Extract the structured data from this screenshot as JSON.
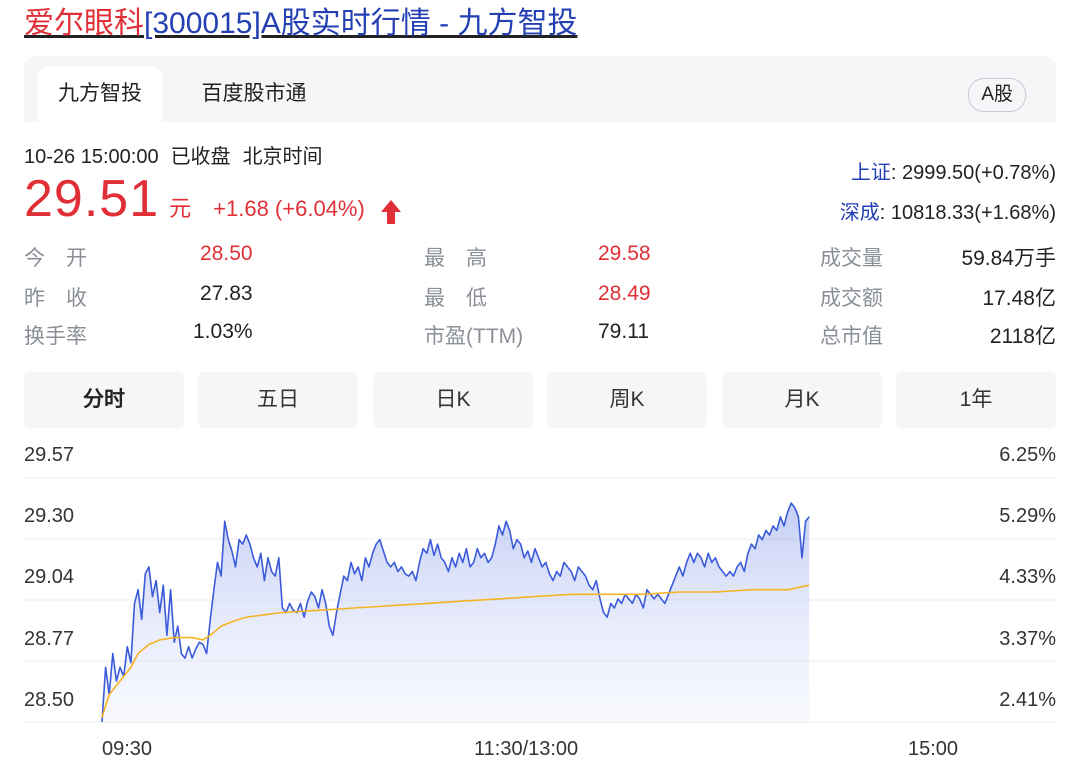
{
  "header": {
    "title_stock": "爱尔眼科",
    "title_rest": "[300015]A股实时行情 - 九方智投"
  },
  "tabs": [
    {
      "label": "九方智投",
      "active": true
    },
    {
      "label": "百度股市通",
      "active": false
    }
  ],
  "market_badge": "A股",
  "quote": {
    "datetime": "10-26 15:00:00",
    "status": "已收盘",
    "timezone": "北京时间",
    "price": "29.51",
    "unit": "元",
    "change": "+1.68 (+6.04%)"
  },
  "indices": [
    {
      "name": "上证",
      "value": ": 2999.50(+0.78%)"
    },
    {
      "name": "深成",
      "value": ": 10818.33(+1.68%)"
    }
  ],
  "stats": {
    "open_label": "今　开",
    "open": "28.50",
    "prev_close_label": "昨　收",
    "prev_close": "27.83",
    "turnover_label": "换手率",
    "turnover": "1.03%",
    "high_label": "最　高",
    "high": "29.58",
    "low_label": "最　低",
    "low": "28.49",
    "pe_label": "市盈(TTM)",
    "pe": "79.11",
    "volume_label": "成交量",
    "volume": "59.84万手",
    "amount_label": "成交额",
    "amount": "17.48亿",
    "mktcap_label": "总市值",
    "mktcap": "2118亿"
  },
  "periods": [
    {
      "label": "分时",
      "active": true
    },
    {
      "label": "五日",
      "active": false
    },
    {
      "label": "日K",
      "active": false
    },
    {
      "label": "周K",
      "active": false
    },
    {
      "label": "月K",
      "active": false
    },
    {
      "label": "1年",
      "active": false
    }
  ],
  "colors": {
    "red": "#e02f36",
    "blue": "#2440b3",
    "price_line": "#3b5bdb",
    "avg_line": "#f5b324"
  },
  "chart_data": {
    "type": "line",
    "title": "",
    "y_ticks_left": [
      "29.57",
      "29.30",
      "29.04",
      "28.77",
      "28.50"
    ],
    "y_ticks_right": [
      "6.25%",
      "5.29%",
      "4.33%",
      "3.37%",
      "2.41%"
    ],
    "x_ticks": [
      "09:30",
      "11:30/13:00",
      "15:00"
    ],
    "ylim": [
      28.5,
      29.57
    ],
    "xlim": [
      0,
      240
    ],
    "series": [
      {
        "values": [
          [
            0,
            28.5
          ],
          [
            1,
            28.74
          ],
          [
            2,
            28.62
          ],
          [
            3,
            28.8
          ],
          [
            4,
            28.68
          ],
          [
            5,
            28.74
          ],
          [
            6,
            28.7
          ],
          [
            7,
            28.83
          ],
          [
            8,
            28.76
          ],
          [
            9,
            29.02
          ],
          [
            10,
            29.08
          ],
          [
            11,
            28.95
          ],
          [
            12,
            29.15
          ],
          [
            13,
            29.18
          ],
          [
            14,
            29.05
          ],
          [
            15,
            29.12
          ],
          [
            16,
            28.98
          ],
          [
            17,
            29.1
          ],
          [
            18,
            28.88
          ],
          [
            19,
            29.08
          ],
          [
            20,
            28.85
          ],
          [
            21,
            28.92
          ],
          [
            22,
            28.8
          ],
          [
            23,
            28.78
          ],
          [
            24,
            28.83
          ],
          [
            25,
            28.78
          ],
          [
            26,
            28.82
          ],
          [
            27,
            28.85
          ],
          [
            28,
            28.84
          ],
          [
            29,
            28.8
          ],
          [
            30,
            28.95
          ],
          [
            31,
            29.08
          ],
          [
            32,
            29.2
          ],
          [
            33,
            29.14
          ],
          [
            34,
            29.38
          ],
          [
            35,
            29.3
          ],
          [
            36,
            29.25
          ],
          [
            37,
            29.18
          ],
          [
            38,
            29.3
          ],
          [
            39,
            29.28
          ],
          [
            40,
            29.32
          ],
          [
            41,
            29.28
          ],
          [
            42,
            29.22
          ],
          [
            43,
            29.18
          ],
          [
            44,
            29.24
          ],
          [
            45,
            29.12
          ],
          [
            46,
            29.22
          ],
          [
            47,
            29.16
          ],
          [
            48,
            29.14
          ],
          [
            49,
            29.22
          ],
          [
            50,
            29.0
          ],
          [
            51,
            28.98
          ],
          [
            52,
            29.02
          ],
          [
            53,
            28.99
          ],
          [
            54,
            28.98
          ],
          [
            55,
            29.02
          ],
          [
            56,
            28.96
          ],
          [
            57,
            29.03
          ],
          [
            58,
            29.07
          ],
          [
            59,
            29.05
          ],
          [
            60,
            29.0
          ],
          [
            61,
            29.08
          ],
          [
            62,
            29.02
          ],
          [
            63,
            28.92
          ],
          [
            64,
            28.88
          ],
          [
            65,
            28.98
          ],
          [
            66,
            29.06
          ],
          [
            67,
            29.14
          ],
          [
            68,
            29.12
          ],
          [
            69,
            29.2
          ],
          [
            70,
            29.15
          ],
          [
            71,
            29.18
          ],
          [
            72,
            29.12
          ],
          [
            73,
            29.22
          ],
          [
            74,
            29.18
          ],
          [
            75,
            29.24
          ],
          [
            76,
            29.28
          ],
          [
            77,
            29.3
          ],
          [
            78,
            29.25
          ],
          [
            79,
            29.2
          ],
          [
            80,
            29.18
          ],
          [
            81,
            29.2
          ],
          [
            82,
            29.16
          ],
          [
            83,
            29.18
          ],
          [
            84,
            29.15
          ],
          [
            85,
            29.14
          ],
          [
            86,
            29.16
          ],
          [
            87,
            29.12
          ],
          [
            88,
            29.2
          ],
          [
            89,
            29.26
          ],
          [
            90,
            29.24
          ],
          [
            91,
            29.3
          ],
          [
            92,
            29.23
          ],
          [
            93,
            29.28
          ],
          [
            94,
            29.22
          ],
          [
            95,
            29.2
          ],
          [
            96,
            29.16
          ],
          [
            97,
            29.22
          ],
          [
            98,
            29.18
          ],
          [
            99,
            29.24
          ],
          [
            100,
            29.2
          ],
          [
            101,
            29.26
          ],
          [
            102,
            29.18
          ],
          [
            103,
            29.2
          ],
          [
            104,
            29.26
          ],
          [
            105,
            29.22
          ],
          [
            106,
            29.24
          ],
          [
            107,
            29.2
          ],
          [
            108,
            29.22
          ],
          [
            109,
            29.28
          ],
          [
            110,
            29.36
          ],
          [
            111,
            29.32
          ],
          [
            112,
            29.38
          ],
          [
            113,
            29.34
          ],
          [
            114,
            29.26
          ],
          [
            115,
            29.3
          ],
          [
            116,
            29.28
          ],
          [
            117,
            29.22
          ],
          [
            118,
            29.25
          ],
          [
            119,
            29.2
          ],
          [
            120,
            29.26
          ],
          [
            121,
            29.22
          ],
          [
            122,
            29.18
          ],
          [
            123,
            29.2
          ],
          [
            124,
            29.15
          ],
          [
            125,
            29.12
          ],
          [
            126,
            29.16
          ],
          [
            127,
            29.14
          ],
          [
            128,
            29.2
          ],
          [
            129,
            29.18
          ],
          [
            130,
            29.16
          ],
          [
            131,
            29.12
          ],
          [
            132,
            29.18
          ],
          [
            133,
            29.16
          ],
          [
            134,
            29.14
          ],
          [
            135,
            29.1
          ],
          [
            136,
            29.08
          ],
          [
            137,
            29.12
          ],
          [
            138,
            29.04
          ],
          [
            139,
            28.98
          ],
          [
            140,
            28.96
          ],
          [
            141,
            29.02
          ],
          [
            142,
            29.0
          ],
          [
            143,
            29.04
          ],
          [
            144,
            29.02
          ],
          [
            145,
            29.06
          ],
          [
            146,
            29.04
          ],
          [
            147,
            29.02
          ],
          [
            148,
            29.06
          ],
          [
            149,
            29.04
          ],
          [
            150,
            29.0
          ],
          [
            151,
            29.08
          ],
          [
            152,
            29.06
          ],
          [
            153,
            29.04
          ],
          [
            154,
            29.06
          ],
          [
            155,
            29.04
          ],
          [
            156,
            29.02
          ],
          [
            157,
            29.06
          ],
          [
            158,
            29.1
          ],
          [
            159,
            29.14
          ],
          [
            160,
            29.18
          ],
          [
            161,
            29.14
          ],
          [
            162,
            29.2
          ],
          [
            163,
            29.24
          ],
          [
            164,
            29.2
          ],
          [
            165,
            29.24
          ],
          [
            166,
            29.22
          ],
          [
            167,
            29.18
          ],
          [
            168,
            29.24
          ],
          [
            169,
            29.2
          ],
          [
            170,
            29.22
          ],
          [
            171,
            29.18
          ],
          [
            172,
            29.16
          ],
          [
            173,
            29.14
          ],
          [
            174,
            29.16
          ],
          [
            175,
            29.14
          ],
          [
            176,
            29.18
          ],
          [
            177,
            29.2
          ],
          [
            178,
            29.16
          ],
          [
            179,
            29.24
          ],
          [
            180,
            29.28
          ],
          [
            181,
            29.26
          ],
          [
            182,
            29.32
          ],
          [
            183,
            29.3
          ],
          [
            184,
            29.34
          ],
          [
            185,
            29.32
          ],
          [
            186,
            29.36
          ],
          [
            187,
            29.34
          ],
          [
            188,
            29.4
          ],
          [
            189,
            29.36
          ],
          [
            190,
            29.42
          ],
          [
            191,
            29.46
          ],
          [
            192,
            29.44
          ],
          [
            193,
            29.4
          ],
          [
            194,
            29.22
          ],
          [
            195,
            29.38
          ],
          [
            196,
            29.4
          ]
        ]
      },
      {
        "values": [
          [
            0,
            28.52
          ],
          [
            2,
            28.62
          ],
          [
            5,
            28.68
          ],
          [
            8,
            28.74
          ],
          [
            10,
            28.8
          ],
          [
            13,
            28.84
          ],
          [
            16,
            28.86
          ],
          [
            20,
            28.87
          ],
          [
            25,
            28.87
          ],
          [
            28,
            28.86
          ],
          [
            30,
            28.88
          ],
          [
            33,
            28.92
          ],
          [
            36,
            28.94
          ],
          [
            40,
            28.96
          ],
          [
            45,
            28.97
          ],
          [
            50,
            28.98
          ],
          [
            60,
            28.99
          ],
          [
            70,
            29.0
          ],
          [
            80,
            29.01
          ],
          [
            90,
            29.02
          ],
          [
            100,
            29.03
          ],
          [
            110,
            29.04
          ],
          [
            120,
            29.05
          ],
          [
            130,
            29.06
          ],
          [
            140,
            29.06
          ],
          [
            150,
            29.06
          ],
          [
            160,
            29.07
          ],
          [
            170,
            29.07
          ],
          [
            180,
            29.08
          ],
          [
            190,
            29.08
          ],
          [
            196,
            29.1
          ]
        ]
      }
    ]
  }
}
